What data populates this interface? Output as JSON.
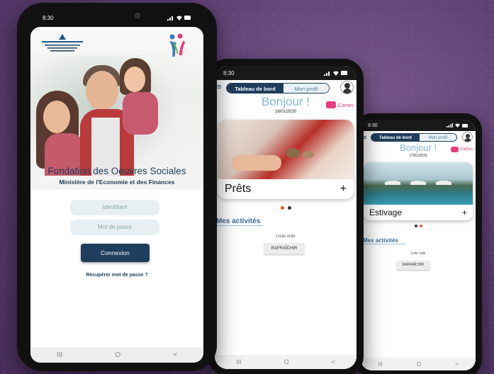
{
  "phone1": {
    "time": "8:30",
    "logo_text": "Ministère de l'Économie et des Finances",
    "foundation_title": "Fondation des Oeuvres Sociales",
    "ministry_subtitle": "Ministère de l'Economie et des Finances",
    "username_placeholder": "Identifiant",
    "password_placeholder": "Mot de passe",
    "login_label": "Connexion",
    "recover_label": "Récupérer mot de passe ?",
    "nav": [
      "III",
      "O",
      "<"
    ]
  },
  "phone2": {
    "time": "8:30",
    "tab_dashboard": "Tableau de bord",
    "tab_profile": "Mon profil",
    "greeting": "Bonjour !",
    "date": "16/01/2020",
    "cartes_label": "Cartes",
    "card_title": "Prêts",
    "card_action": "+",
    "activities_title": "Mes activités",
    "empty_label": "Liste vide",
    "refresh_label": "RAFRAÎCHIR",
    "nav": [
      "III",
      "O",
      "<"
    ]
  },
  "phone3": {
    "time": "8:30",
    "tab_dashboard": "Tableau de bord",
    "tab_profile": "Mon profil",
    "greeting": "Bonjour !",
    "date": "17/01/2020",
    "cartes_label": "Cartes",
    "card_title": "Estivage",
    "card_action": "+",
    "activities_title": "Mes activités",
    "empty_label": "Liste vide",
    "refresh_label": "RAFRAÎCHIR",
    "nav": [
      "III",
      "O",
      "<"
    ]
  },
  "colors": {
    "background": "#5e3f73",
    "primary_navy": "#1f3d5c",
    "greeting_blue": "#86b8d8",
    "accent_pink": "#e73c7e",
    "pager_active": "#e8562a",
    "pager_inactive": "#333333"
  },
  "icons": [
    "menu-icon",
    "avatar",
    "cartes-icon",
    "plus-icon",
    "signal-icon",
    "wifi-icon",
    "battery-icon"
  ]
}
